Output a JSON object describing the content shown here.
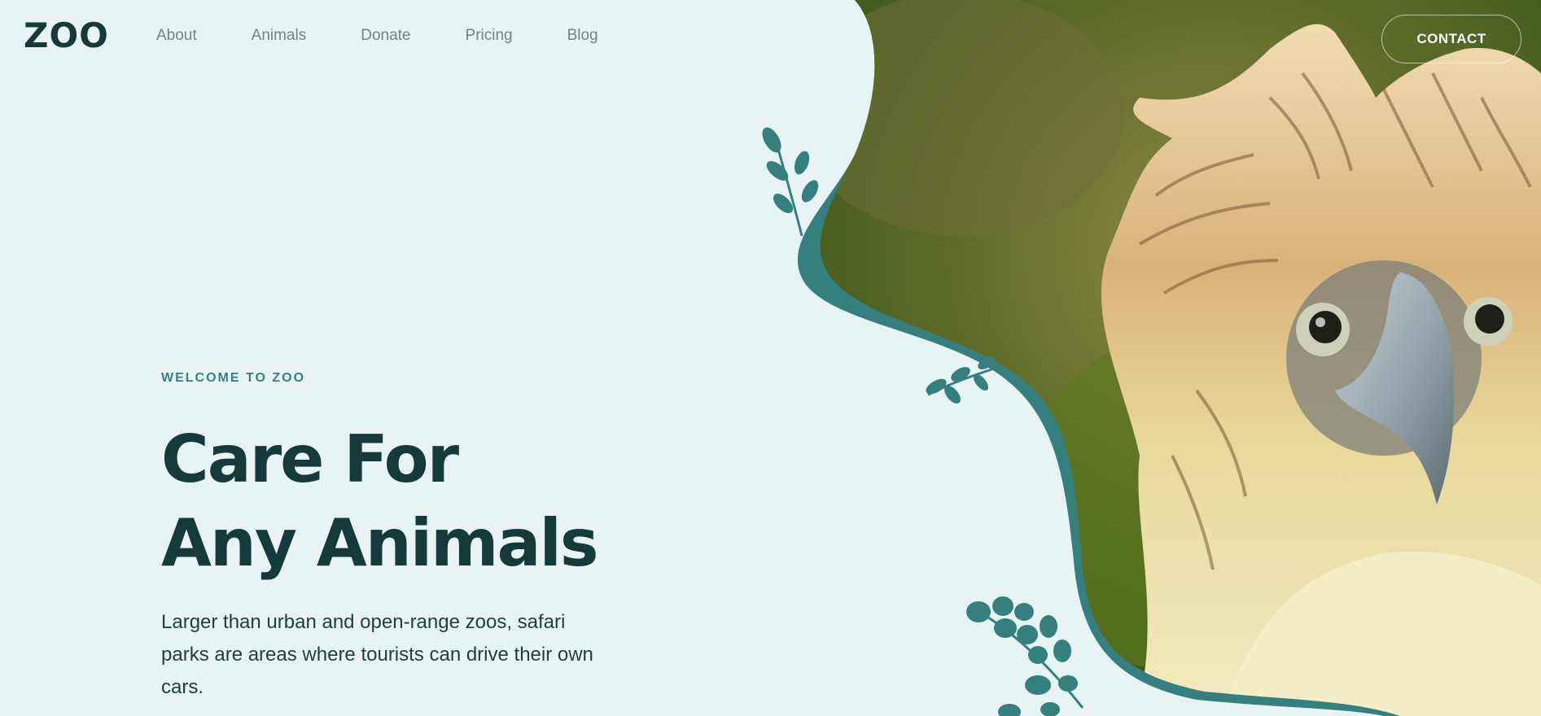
{
  "header": {
    "logo": "ZOO",
    "nav": [
      "About",
      "Animals",
      "Donate",
      "Pricing",
      "Blog"
    ],
    "contact_label": "CONTACT"
  },
  "hero": {
    "eyebrow": "WELCOME TO ZOO",
    "title_line1": "Care For",
    "title_line2": "Any Animals",
    "description": "Larger than urban and open-range zoos, safari parks are areas where tourists can drive their own cars."
  },
  "colors": {
    "background": "#e8f4f3",
    "accent": "#3a7f7e",
    "dark_text": "#163a3a",
    "nav_text": "#6d8684"
  }
}
